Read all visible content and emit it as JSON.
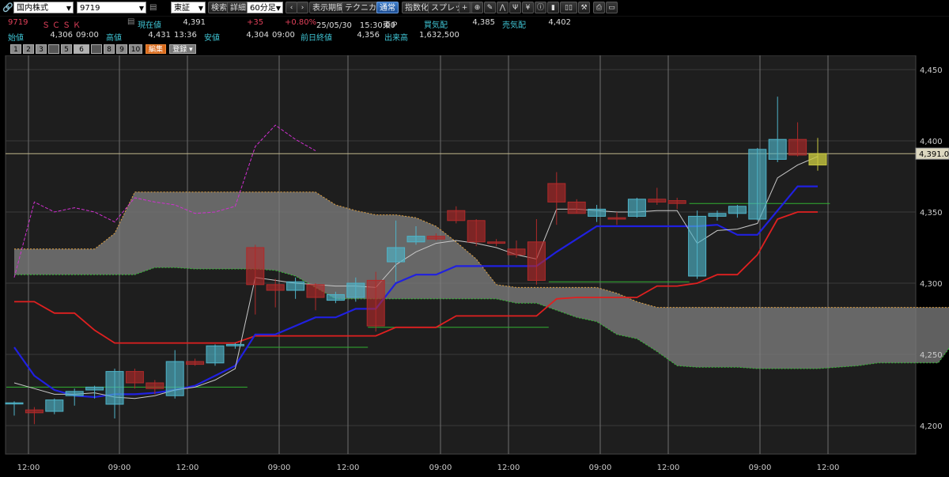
{
  "toolbar": {
    "market_select": "国内株式",
    "code_input": "9719",
    "exchange_select": "東証",
    "search": "検索",
    "detail": "詳細",
    "interval_select": "60分足",
    "period": "表示期間",
    "technical": "テクニカル",
    "normal": "通常",
    "index": "指数化",
    "spread": "スプレッド"
  },
  "quote": {
    "code": "9719",
    "name": "ＳＣＳＫ",
    "current_label": "現在値",
    "current": "4,391",
    "change": "+35",
    "change_pct": "+0.80%",
    "datetime": "25/05/30　15:30:00",
    "market": "東Ｐ",
    "bid_label": "買気配",
    "bid": "4,385",
    "ask_label": "売気配",
    "ask": "4,402",
    "open_label": "始値",
    "open": "4,306",
    "open_time": "09:00",
    "high_label": "高値",
    "high": "4,431",
    "high_time": "13:36",
    "low_label": "安値",
    "low": "4,304",
    "low_time": "09:00",
    "prev_label": "前日終値",
    "prev": "4,356",
    "volume_label": "出来高",
    "volume": "1,632,500"
  },
  "panel_buttons": [
    "1",
    "2",
    "3",
    "",
    "5",
    "6",
    "",
    "8",
    "9",
    "10"
  ],
  "edit_button": "編集",
  "register_button": "登録",
  "chart_data": {
    "type": "candlestick",
    "ylim": [
      4180,
      4460
    ],
    "yticks": [
      {
        "v": 4200,
        "label": "4,200"
      },
      {
        "v": 4250,
        "label": "4,250"
      },
      {
        "v": 4300,
        "label": "4,300"
      },
      {
        "v": 4350,
        "label": "4,350"
      },
      {
        "v": 4400,
        "label": "4,400"
      },
      {
        "v": 4450,
        "label": "4,450"
      }
    ],
    "xticks": [
      "12:00",
      "09:00",
      "12:00",
      "09:00",
      "12:00",
      "09:00",
      "12:00",
      "09:00",
      "12:00",
      "09:00",
      "12:00"
    ],
    "last_price": 4391,
    "last_price_label": "4,391.0",
    "colors": {
      "up": "#4fb3c8",
      "down": "#b02a2a",
      "last": "#c8c840",
      "tenkan": "#e02020",
      "kijun": "#2020e0",
      "chikou": "#d030d0",
      "ma": "#c8c8c8",
      "cloud": "#808080"
    },
    "candles": [
      {
        "o": 4216,
        "h": 4217,
        "l": 4207,
        "c": 4216
      },
      {
        "o": 4211,
        "h": 4213,
        "l": 4201,
        "c": 4209
      },
      {
        "o": 4210,
        "h": 4219,
        "l": 4208,
        "c": 4218
      },
      {
        "o": 4221,
        "h": 4226,
        "l": 4214,
        "c": 4224
      },
      {
        "o": 4225,
        "h": 4228,
        "l": 4219,
        "c": 4227
      },
      {
        "o": 4215,
        "h": 4240,
        "l": 4205,
        "c": 4238
      },
      {
        "o": 4238,
        "h": 4240,
        "l": 4226,
        "c": 4230
      },
      {
        "o": 4230,
        "h": 4232,
        "l": 4222,
        "c": 4226
      },
      {
        "o": 4221,
        "h": 4253,
        "l": 4219,
        "c": 4245
      },
      {
        "o": 4245,
        "h": 4247,
        "l": 4242,
        "c": 4243
      },
      {
        "o": 4244,
        "h": 4257,
        "l": 4242,
        "c": 4256
      },
      {
        "o": 4256,
        "h": 4258,
        "l": 4254,
        "c": 4257
      },
      {
        "o": 4325,
        "h": 4327,
        "l": 4278,
        "c": 4299
      },
      {
        "o": 4299,
        "h": 4303,
        "l": 4283,
        "c": 4295
      },
      {
        "o": 4295,
        "h": 4304,
        "l": 4289,
        "c": 4301
      },
      {
        "o": 4299,
        "h": 4300,
        "l": 4281,
        "c": 4290
      },
      {
        "o": 4288,
        "h": 4294,
        "l": 4286,
        "c": 4292
      },
      {
        "o": 4290,
        "h": 4304,
        "l": 4287,
        "c": 4300
      },
      {
        "o": 4302,
        "h": 4308,
        "l": 4266,
        "c": 4270
      },
      {
        "o": 4315,
        "h": 4344,
        "l": 4301,
        "c": 4325
      },
      {
        "o": 4329,
        "h": 4340,
        "l": 4327,
        "c": 4333
      },
      {
        "o": 4333,
        "h": 4335,
        "l": 4330,
        "c": 4331
      },
      {
        "o": 4351,
        "h": 4354,
        "l": 4342,
        "c": 4344
      },
      {
        "o": 4344,
        "h": 4345,
        "l": 4326,
        "c": 4329
      },
      {
        "o": 4329,
        "h": 4331,
        "l": 4326,
        "c": 4328
      },
      {
        "o": 4324,
        "h": 4330,
        "l": 4318,
        "c": 4320
      },
      {
        "o": 4329,
        "h": 4345,
        "l": 4299,
        "c": 4302
      },
      {
        "o": 4370,
        "h": 4378,
        "l": 4341,
        "c": 4357
      },
      {
        "o": 4357,
        "h": 4359,
        "l": 4349,
        "c": 4349
      },
      {
        "o": 4347,
        "h": 4355,
        "l": 4343,
        "c": 4352
      },
      {
        "o": 4346,
        "h": 4350,
        "l": 4341,
        "c": 4345
      },
      {
        "o": 4347,
        "h": 4360,
        "l": 4346,
        "c": 4359
      },
      {
        "o": 4359,
        "h": 4367,
        "l": 4355,
        "c": 4357
      },
      {
        "o": 4358,
        "h": 4360,
        "l": 4352,
        "c": 4356
      },
      {
        "o": 4305,
        "h": 4351,
        "l": 4303,
        "c": 4347
      },
      {
        "o": 4347,
        "h": 4351,
        "l": 4344,
        "c": 4349
      },
      {
        "o": 4349,
        "h": 4355,
        "l": 4346,
        "c": 4354
      },
      {
        "o": 4345,
        "h": 4395,
        "l": 4344,
        "c": 4394
      },
      {
        "o": 4387,
        "h": 4431,
        "l": 4385,
        "c": 4401
      },
      {
        "o": 4401,
        "h": 4413,
        "l": 4389,
        "c": 4390
      },
      {
        "o": 4383,
        "h": 4402,
        "l": 4379,
        "c": 4391
      }
    ],
    "tenkan": [
      4287,
      4287,
      4279,
      4279,
      4267,
      4258,
      4258,
      4258,
      4258,
      4258,
      4258,
      4258,
      4263,
      4263,
      4263,
      4263,
      4263,
      4263,
      4263,
      4269,
      4269,
      4269,
      4277,
      4277,
      4277,
      4277,
      4277,
      4289,
      4290,
      4290,
      4290,
      4290,
      4298,
      4298,
      4300,
      4306,
      4306,
      4320,
      4345,
      4350,
      4350
    ],
    "kijun": [
      4255,
      4235,
      4225,
      4221,
      4220,
      4222,
      4222,
      4223,
      4225,
      4228,
      4235,
      4242,
      4264,
      4264,
      4270,
      4276,
      4276,
      4282,
      4282,
      4300,
      4306,
      4306,
      4312,
      4312,
      4312,
      4312,
      4312,
      4322,
      4331,
      4340,
      4340,
      4340,
      4340,
      4340,
      4340,
      4341,
      4334,
      4334,
      4351,
      4368,
      4368
    ],
    "ma": [
      4230,
      4226,
      4222,
      4222,
      4223,
      4220,
      4219,
      4221,
      4225,
      4227,
      4232,
      4240,
      4304,
      4302,
      4300,
      4299,
      4298,
      4298,
      4297,
      4313,
      4322,
      4328,
      4330,
      4328,
      4325,
      4320,
      4317,
      4352,
      4352,
      4351,
      4350,
      4350,
      4351,
      4351,
      4328,
      4337,
      4338,
      4342,
      4374,
      4383,
      4389
    ],
    "chikou": [
      4304,
      4357,
      4350,
      4353,
      4350,
      4343,
      4360,
      4357,
      4355,
      4349,
      4350,
      4354,
      4396,
      4411,
      4401,
      4393
    ],
    "cloud_a": [
      4324,
      4324,
      4324,
      4324,
      4324,
      4335,
      4364,
      4364,
      4364,
      4364,
      4364,
      4364,
      4364,
      4364,
      4364,
      4364,
      4355,
      4351,
      4348,
      4348,
      4346,
      4340,
      4329,
      4317,
      4299,
      4297,
      4297,
      4297,
      4297,
      4297,
      4293,
      4287,
      4283,
      4283,
      4283,
      4283,
      4283,
      4283,
      4283,
      4283,
      4283,
      4283,
      4283,
      4283,
      4283,
      4283,
      4283,
      4283,
      4283,
      4283,
      4283,
      4283
    ],
    "cloud_b": [
      4306,
      4306,
      4306,
      4306,
      4306,
      4306,
      4306,
      4311,
      4311,
      4310,
      4310,
      4310,
      4310,
      4309,
      4305,
      4297,
      4289,
      4289,
      4289,
      4289,
      4289,
      4289,
      4289,
      4289,
      4289,
      4286,
      4286,
      4281,
      4276,
      4273,
      4264,
      4261,
      4252,
      4242,
      4241,
      4241,
      4241,
      4240,
      4240,
      4240,
      4240,
      4241,
      4242,
      4244,
      4244,
      4244,
      4244,
      4263,
      4263,
      4266,
      4268,
      4268
    ],
    "hlines": [
      {
        "y": 4227,
        "i0": 0,
        "i1": 12
      },
      {
        "y": 4255,
        "i0": 12,
        "i1": 18
      },
      {
        "y": 4269,
        "i0": 18,
        "i1": 27
      },
      {
        "y": 4301,
        "i0": 27,
        "i1": 34
      },
      {
        "y": 4356,
        "i0": 34,
        "i1": 41
      }
    ]
  }
}
